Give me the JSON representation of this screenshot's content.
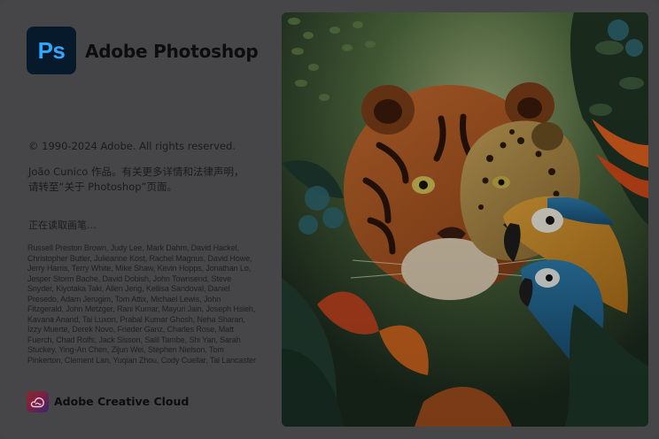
{
  "app": {
    "logo_text": "Ps",
    "name": "Adobe Photoshop"
  },
  "copyright": "© 1990-2024 Adobe. All rights reserved.",
  "artist_credit": "João Cunico 作品。有关更多详情和法律声明，请转至“关于 Photoshop”页面。",
  "status": "正在读取画笔...",
  "credits": "Russell Preston Brown, Judy Lee, Mark Dahm, David Hackel, Christopher Butler, Julieanne Kost, Rachel Magnus, David Howe, Jerry Harris, Terry White, Mike Shaw, Kevin Hopps, Jonathan Lo, Jesper Storm Bache, David Dobish, John Townsend, Steve Snyder, Kiyotaka Taki, Allen Jeng, Kellisa Sandoval, Daniel Presedo, Adam Jerugim, Tom Attix, Michael Lewis, John Fitzgerald, John Metzger, Rani Kumar, Mayuri Jain, Joseph Hsieh, Kavana Anand, Tai Luxon, Prabal Kumar Ghosh, Neha Sharan, Izzy Muerte, Derek Novo, Frieder Ganz, Charles Rose, Matt Fuerch, Chad Rolfs, Jack Sisson, Salil Tambe, Shi Yan, Sarah Stuckey, Ying-An Chen, Zijun Wei, Stephen Nielson, Tom Pinkerton, Clement Lan, Yuqian Zhou, Cody Cuellar, Tal Lancaster",
  "footer": {
    "brand": "Adobe Creative Cloud"
  },
  "colors": {
    "ps_blue": "#31a8ff",
    "ps_dark": "#061a2c",
    "panel_bg": "#464648"
  },
  "icons": {
    "app": "photoshop-icon",
    "footer": "creative-cloud-icon"
  }
}
